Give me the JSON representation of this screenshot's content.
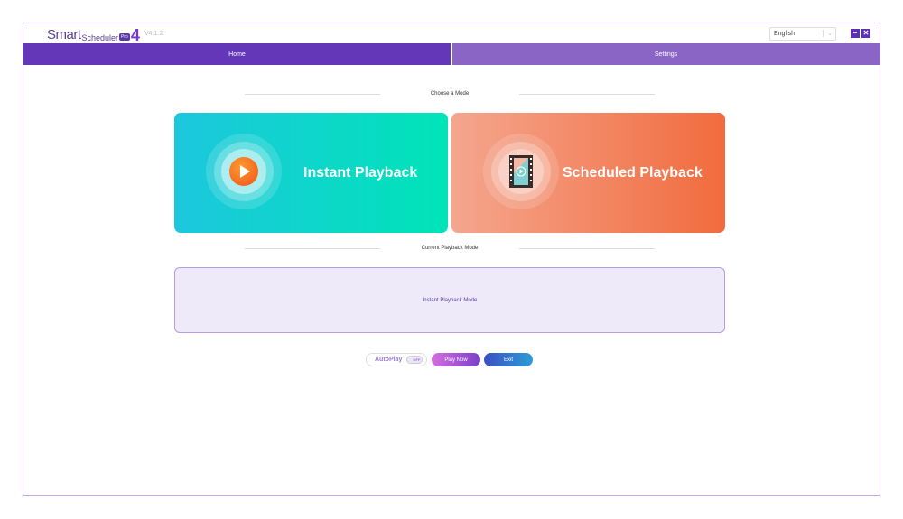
{
  "app": {
    "logo_text": "Smart Scheduler Pro 4",
    "version": "V4.1.2"
  },
  "header": {
    "language": "English",
    "minimize_icon": "minus-icon",
    "close_icon": "x-icon"
  },
  "tabs": [
    {
      "label": "Home",
      "active": true
    },
    {
      "label": "Settings",
      "active": false
    }
  ],
  "main": {
    "choose_mode_label": "Choose a Mode",
    "cards": [
      {
        "title": "Instant Playback",
        "icon": "play-icon"
      },
      {
        "title": "Scheduled Playback",
        "icon": "film-icon"
      }
    ],
    "current_mode_label": "Current Playback Mode",
    "current_mode_value": "Instant Playback Mode",
    "autoplay_label": "AutoPlay",
    "autoplay_toggle": "OFF",
    "autoplay_on": false,
    "play_now_label": "Play Now",
    "exit_label": "Exit"
  },
  "colors": {
    "primary": "#6436b8",
    "tab_inactive": "#8a65c6",
    "instant": "#00e4b8",
    "scheduled": "#f26b3e"
  }
}
